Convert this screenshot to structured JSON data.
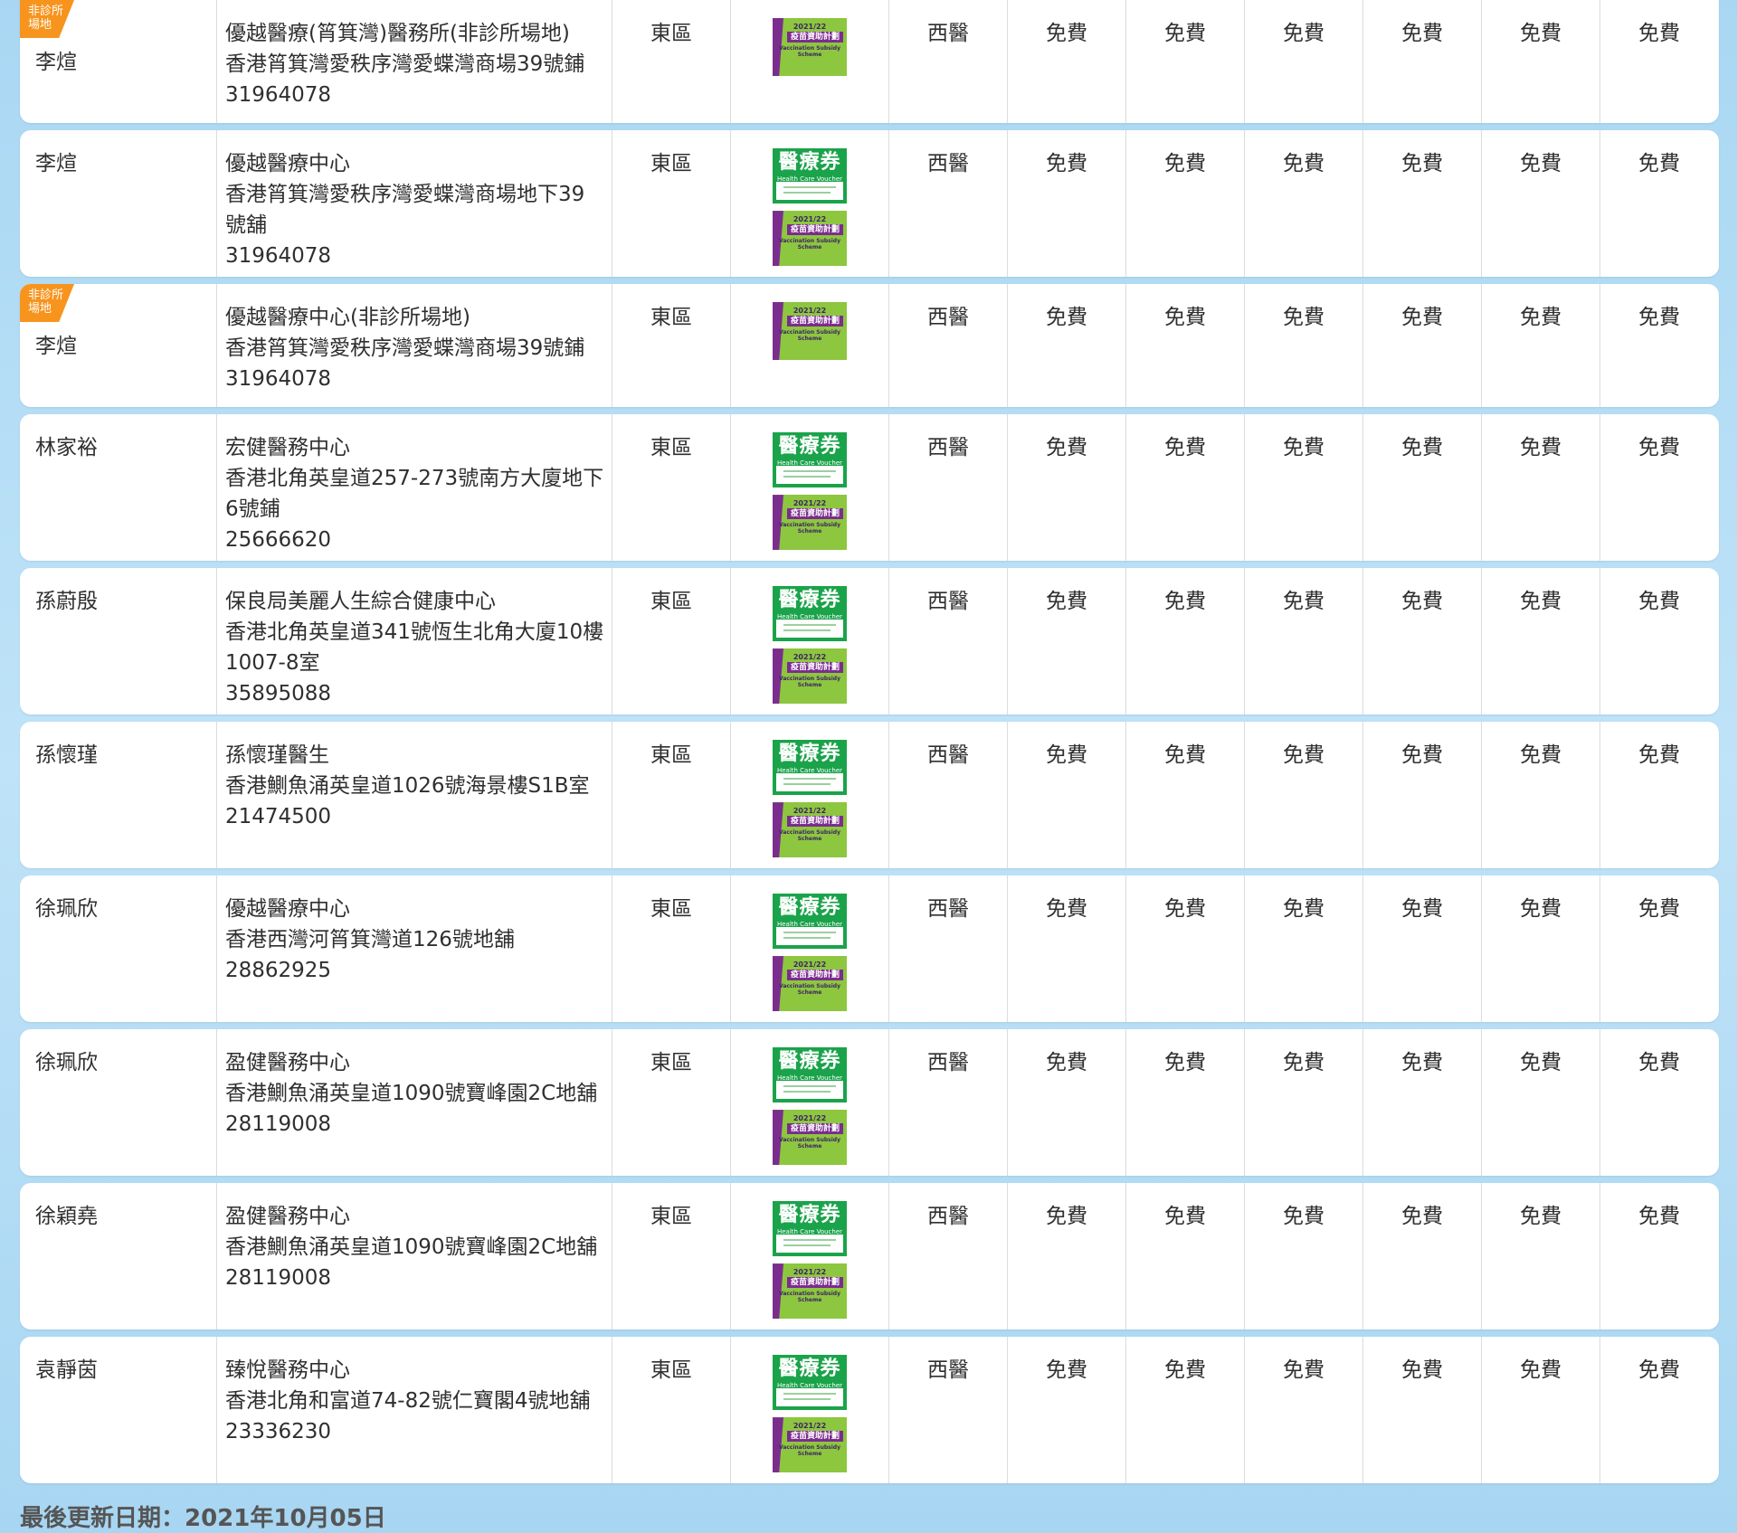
{
  "badge_text": "非診所場地",
  "scheme_logos": {
    "hcv": {
      "zh": "醫療券",
      "en": "Health Care Voucher"
    },
    "vss": {
      "year": "2021/22",
      "zh": "疫苗資助計劃",
      "en": "Vaccination Subsidy Scheme"
    }
  },
  "colors": {
    "badge": "#f7941d",
    "hcv_green": "#1aa34a",
    "vss_green": "#8dc63f",
    "vss_purple": "#7b2d8e"
  },
  "rows": [
    {
      "doctor": "李煊",
      "badge": true,
      "clinic": "優越醫療(筲箕灣)醫務所(非診所場地)",
      "address": "香港筲箕灣愛秩序灣愛蝶灣商場39號鋪",
      "phone": "31964078",
      "district": "東區",
      "schemes": [
        "vss"
      ],
      "type": "西醫",
      "fees": [
        "免費",
        "免費",
        "免費",
        "免費",
        "免費",
        "免費"
      ]
    },
    {
      "doctor": "李煊",
      "badge": false,
      "clinic": "優越醫療中心",
      "address": "香港筲箕灣愛秩序灣愛蝶灣商場地下39號舖",
      "phone": "31964078",
      "district": "東區",
      "schemes": [
        "hcv",
        "vss"
      ],
      "type": "西醫",
      "fees": [
        "免費",
        "免費",
        "免費",
        "免費",
        "免費",
        "免費"
      ]
    },
    {
      "doctor": "李煊",
      "badge": true,
      "clinic": "優越醫療中心(非診所場地)",
      "address": "香港筲箕灣愛秩序灣愛蝶灣商場39號鋪",
      "phone": "31964078",
      "district": "東區",
      "schemes": [
        "vss"
      ],
      "type": "西醫",
      "fees": [
        "免費",
        "免費",
        "免費",
        "免費",
        "免費",
        "免費"
      ]
    },
    {
      "doctor": "林家裕",
      "badge": false,
      "clinic": "宏健醫務中心",
      "address": "香港北角英皇道257-273號南方大廈地下6號鋪",
      "phone": "25666620",
      "district": "東區",
      "schemes": [
        "hcv",
        "vss"
      ],
      "type": "西醫",
      "fees": [
        "免費",
        "免費",
        "免費",
        "免費",
        "免費",
        "免費"
      ]
    },
    {
      "doctor": "孫蔚殷",
      "badge": false,
      "clinic": "保良局美麗人生綜合健康中心",
      "address": "香港北角英皇道341號恆生北角大廈10樓1007-8室",
      "phone": "35895088",
      "district": "東區",
      "schemes": [
        "hcv",
        "vss"
      ],
      "type": "西醫",
      "fees": [
        "免費",
        "免費",
        "免費",
        "免費",
        "免費",
        "免費"
      ]
    },
    {
      "doctor": "孫懷瑾",
      "badge": false,
      "clinic": "孫懷瑾醫生",
      "address": "香港鰂魚涌英皇道1026號海景樓S1B室",
      "phone": "21474500",
      "district": "東區",
      "schemes": [
        "hcv",
        "vss"
      ],
      "type": "西醫",
      "fees": [
        "免費",
        "免費",
        "免費",
        "免費",
        "免費",
        "免費"
      ]
    },
    {
      "doctor": "徐珮欣",
      "badge": false,
      "clinic": "優越醫療中心",
      "address": "香港西灣河筲箕灣道126號地舖",
      "phone": "28862925",
      "district": "東區",
      "schemes": [
        "hcv",
        "vss"
      ],
      "type": "西醫",
      "fees": [
        "免費",
        "免費",
        "免費",
        "免費",
        "免費",
        "免費"
      ]
    },
    {
      "doctor": "徐珮欣",
      "badge": false,
      "clinic": "盈健醫務中心",
      "address": "香港鰂魚涌英皇道1090號寶峰園2C地舖",
      "phone": "28119008",
      "district": "東區",
      "schemes": [
        "hcv",
        "vss"
      ],
      "type": "西醫",
      "fees": [
        "免費",
        "免費",
        "免費",
        "免費",
        "免費",
        "免費"
      ]
    },
    {
      "doctor": "徐穎堯",
      "badge": false,
      "clinic": "盈健醫務中心",
      "address": "香港鰂魚涌英皇道1090號寶峰園2C地舖",
      "phone": "28119008",
      "district": "東區",
      "schemes": [
        "hcv",
        "vss"
      ],
      "type": "西醫",
      "fees": [
        "免費",
        "免費",
        "免費",
        "免費",
        "免費",
        "免費"
      ]
    },
    {
      "doctor": "袁靜茵",
      "badge": false,
      "clinic": "臻悅醫務中心",
      "address": "香港北角和富道74-82號仁寶閣4號地舖",
      "phone": "23336230",
      "district": "東區",
      "schemes": [
        "hcv",
        "vss"
      ],
      "type": "西醫",
      "fees": [
        "免費",
        "免費",
        "免費",
        "免費",
        "免費",
        "免費"
      ]
    }
  ],
  "footer": {
    "last_updated": "最後更新日期：2021年10月05日"
  }
}
